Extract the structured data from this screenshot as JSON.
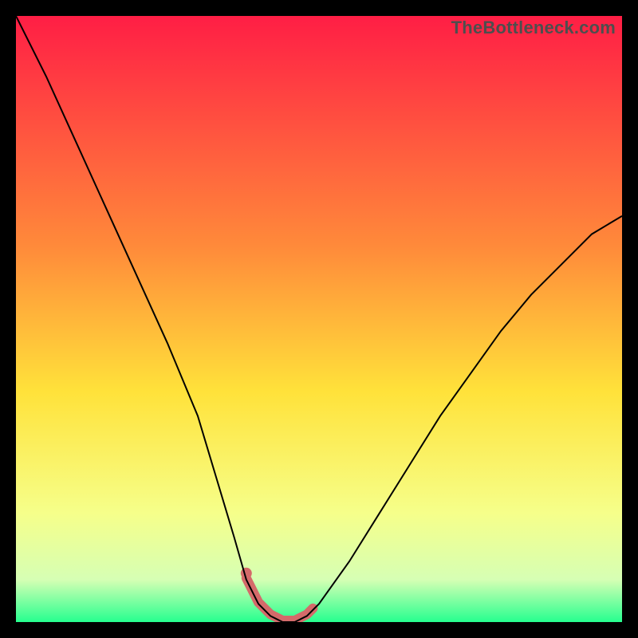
{
  "watermark": "TheBottleneck.com",
  "colors": {
    "gradient_top": "#ff1e45",
    "gradient_mid1": "#ff8a3a",
    "gradient_mid2": "#ffe23a",
    "gradient_mid3": "#f6ff8a",
    "gradient_mid4": "#d6ffb4",
    "gradient_bottom": "#26ff8f",
    "curve": "#000000",
    "floor_emphasis": "#d46a6a",
    "frame": "#000000"
  },
  "chart_data": {
    "type": "line",
    "title": "",
    "xlabel": "",
    "ylabel": "",
    "xlim": [
      0,
      100
    ],
    "ylim": [
      0,
      100
    ],
    "grid": false,
    "series": [
      {
        "name": "bottleneck-curve",
        "x": [
          0,
          5,
          10,
          15,
          20,
          25,
          30,
          33,
          36,
          38,
          40,
          42,
          44,
          46,
          48,
          50,
          55,
          60,
          65,
          70,
          75,
          80,
          85,
          90,
          95,
          100
        ],
        "y": [
          100,
          90,
          79,
          68,
          57,
          46,
          34,
          24,
          14,
          7,
          3,
          1,
          0,
          0,
          1,
          3,
          10,
          18,
          26,
          34,
          41,
          48,
          54,
          59,
          64,
          67
        ]
      }
    ],
    "annotations": {
      "emphasized_floor_range_x": [
        38,
        49
      ],
      "emphasized_dot_x": 38
    }
  }
}
